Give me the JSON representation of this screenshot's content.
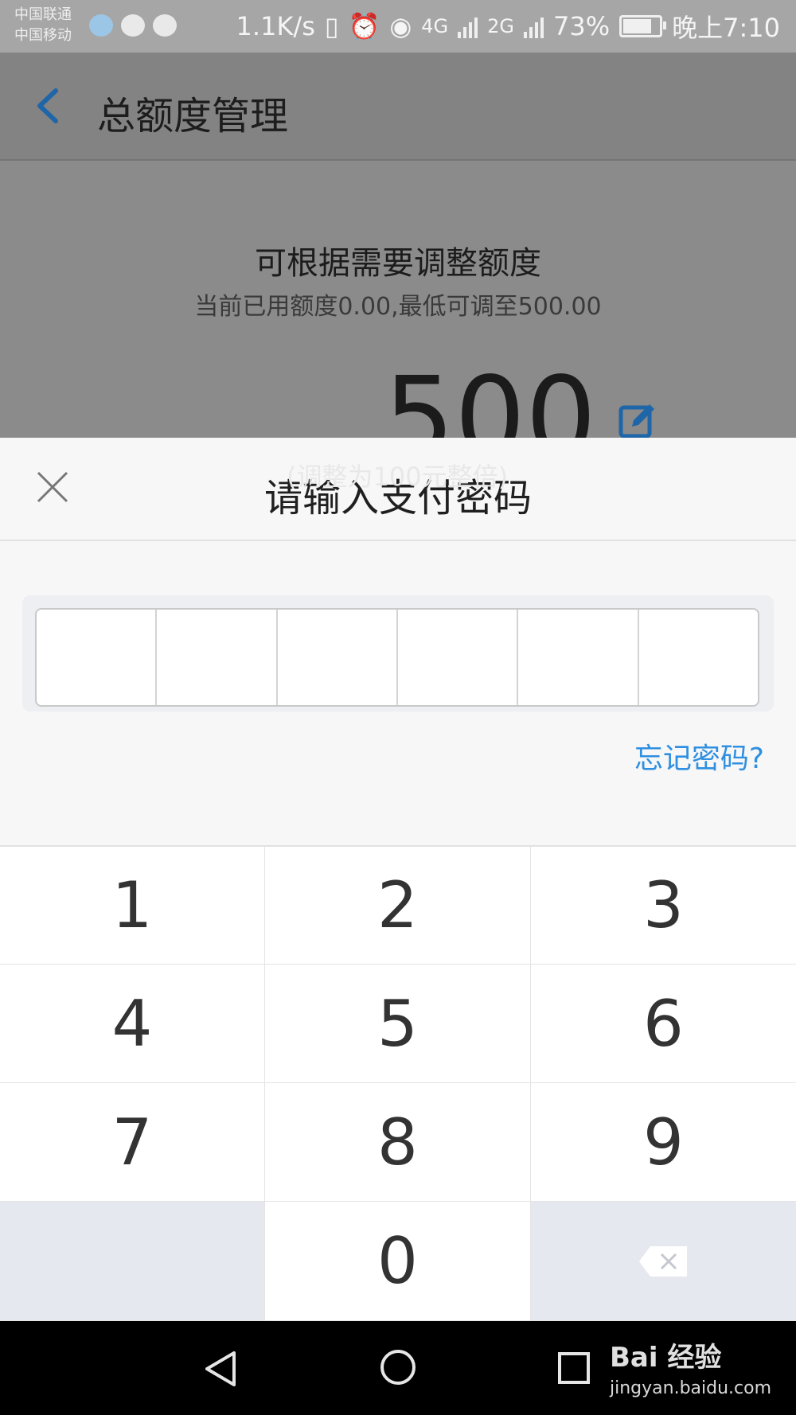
{
  "status_bar": {
    "carrier1": "中国联通",
    "carrier2": "中国移动",
    "speed": "1.1K/s",
    "net1": "4G",
    "net2": "2G",
    "battery": "73%",
    "time": "晚上7:10"
  },
  "background_page": {
    "title": "总额度管理",
    "hint_title": "可根据需要调整额度",
    "hint_sub": "当前已用额度0.00,最低可调至500.00",
    "amount": "500",
    "step_hint": "(调整为100元整倍)"
  },
  "password_sheet": {
    "title": "请输入支付密码",
    "forgot_label": "忘记密码?",
    "cells": [
      "",
      "",
      "",
      "",
      "",
      ""
    ]
  },
  "keypad": {
    "keys": [
      "1",
      "2",
      "3",
      "4",
      "5",
      "6",
      "7",
      "8",
      "9",
      "",
      "0",
      ""
    ]
  },
  "watermark": {
    "logo": "Bai 经验",
    "url": "jingyan.baidu.com"
  },
  "colors": {
    "accent_link": "#2f8fe0",
    "back_arrow": "#1f66a8",
    "keypad_gray": "#e5e8ee"
  },
  "icons": {
    "back": "chevron-left-icon",
    "edit": "edit-icon",
    "close": "close-icon",
    "delete": "backspace-icon"
  }
}
